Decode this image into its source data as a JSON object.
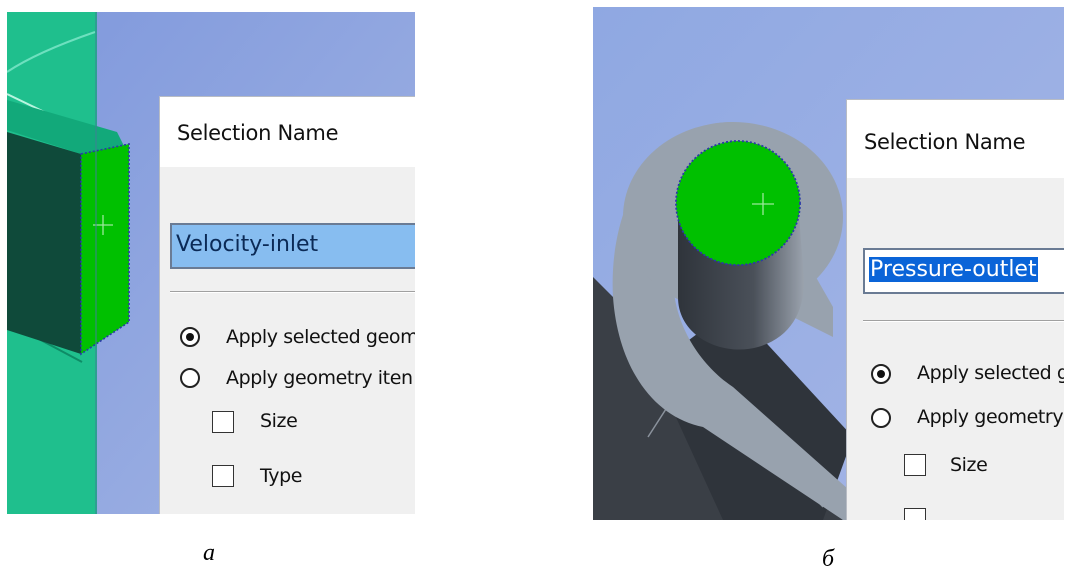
{
  "panel_a": {
    "dialog_title": "Selection Name",
    "name_value": "Velocity-inlet",
    "option_apply_selected": "Apply selected geom",
    "option_apply_geometry": "Apply geometry iten",
    "checkbox_size": "Size",
    "checkbox_type": "Type",
    "caption": "a"
  },
  "panel_b": {
    "dialog_title": "Selection Name",
    "name_value": "Pressure-outlet",
    "option_apply_selected": "Apply selected g",
    "option_apply_geometry": "Apply geometry",
    "checkbox_size": "Size",
    "caption": "б"
  },
  "colors": {
    "background_blue": "#8aa3dd",
    "teal_body": "#1fb98a",
    "dark_face": "#0f4a3a",
    "selected_face": "#00c000",
    "grey_body": "#9aa4b0",
    "dark_grey": "#3c4148",
    "field_highlight": "#87bdf0",
    "text_selection": "#0a64d8"
  }
}
